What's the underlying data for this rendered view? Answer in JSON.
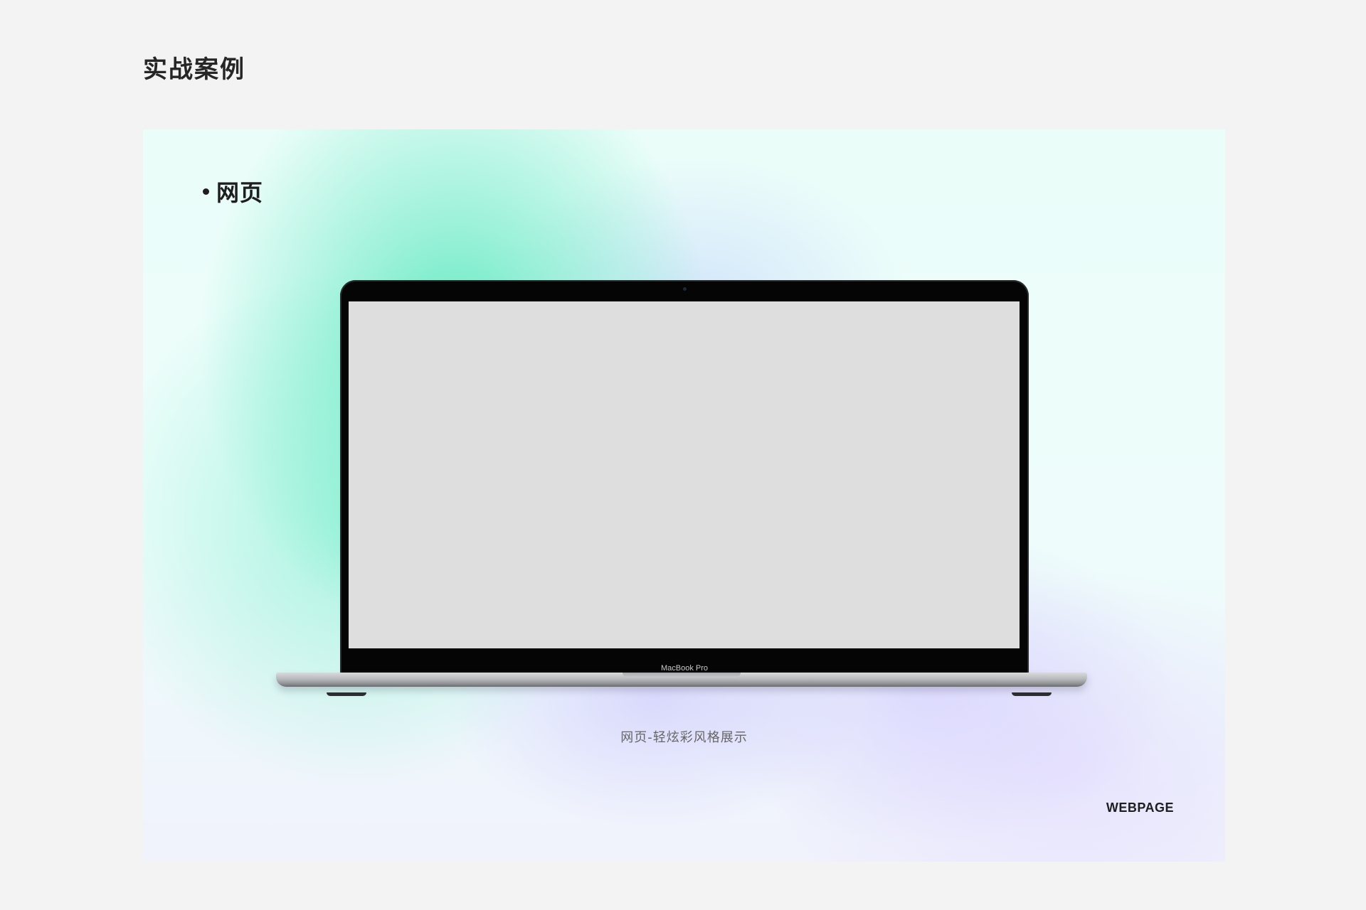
{
  "page": {
    "title": "实战案例"
  },
  "card": {
    "section_label": "网页",
    "device_brand": "MacBook Pro",
    "caption": "网页-轻炫彩风格展示",
    "corner_label": "WEBPAGE"
  },
  "colors": {
    "page_background": "#f3f3f3",
    "accent_green": "#5ce8be",
    "accent_lavender": "#cdc3ff",
    "text_dark": "#1e1e1e",
    "screen_gray": "#dedede"
  }
}
